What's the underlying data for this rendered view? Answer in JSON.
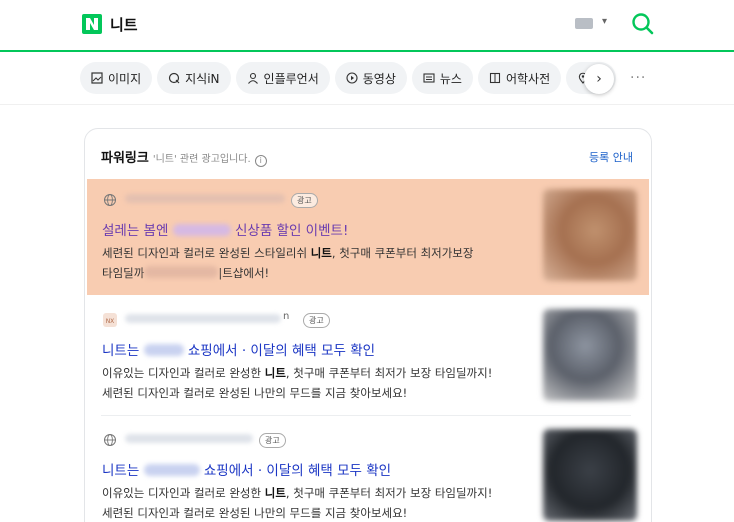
{
  "header": {
    "logo_letter": "N",
    "query": "니트",
    "keyboard_caret": "▾",
    "colors": {
      "brand": "#03c75a"
    }
  },
  "tabs": [
    {
      "label": "이미지",
      "icon": "image-icon"
    },
    {
      "label": "지식iN",
      "icon": "q-icon"
    },
    {
      "label": "인플루언서",
      "icon": "person-icon"
    },
    {
      "label": "동영상",
      "icon": "play-icon"
    },
    {
      "label": "뉴스",
      "icon": "news-icon"
    },
    {
      "label": "어학사전",
      "icon": "book-icon"
    },
    {
      "label": "지",
      "icon": "location-icon"
    }
  ],
  "tab_arrow": "›",
  "more": "···",
  "powerlink": {
    "title": "파워링크",
    "subtitle": "'니트' 관련 광고입니다.",
    "info": "i",
    "register": "등록 안내",
    "ads": [
      {
        "badge": "광고",
        "title_a": "설레는 봄엔",
        "title_b": "신상품 할인 이벤트!",
        "desc1": "세련된 디자인과 컬러로 완성된 스타일리쉬 니트, 첫구매 쿠폰부터 최저가보장",
        "desc2_a": "타임딜까",
        "desc2_b": "|트샵에서!"
      },
      {
        "badge": "광고",
        "url_tail": "n",
        "title_a": "니트는",
        "title_b": "쇼핑에서 · 이달의 혜택 모두 확인",
        "desc1": "이유있는 디자인과 컬러로 완성한 니트, 첫구매 쿠폰부터 최저가 보장 타임딜까지!",
        "desc2": "세련된 디자인과 컬러로 완성된 나만의 무드를 지금 찾아보세요!"
      },
      {
        "badge": "광고",
        "title_a": "니트는",
        "title_b": "쇼핑에서 · 이달의 혜택 모두 확인",
        "desc1": "이유있는 디자인과 컬러로 완성한 니트, 첫구매 쿠폰부터 최저가 보장 타임딜까지!",
        "desc2": "세련된 디자인과 컬러로 완성된 나만의 무드를 지금 찾아보세요!"
      }
    ]
  }
}
